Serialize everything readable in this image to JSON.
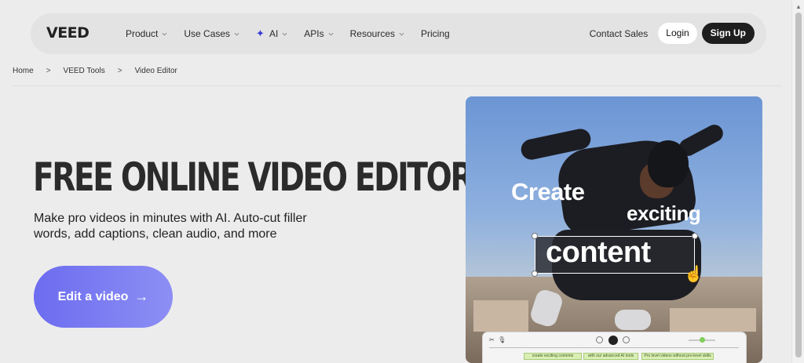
{
  "nav": {
    "logo": "VEED",
    "items": [
      {
        "label": "Product",
        "has_dropdown": true
      },
      {
        "label": "Use Cases",
        "has_dropdown": true
      },
      {
        "label": "AI",
        "has_dropdown": true,
        "icon": "sparkle-icon"
      },
      {
        "label": "APIs",
        "has_dropdown": true
      },
      {
        "label": "Resources",
        "has_dropdown": true
      },
      {
        "label": "Pricing",
        "has_dropdown": false
      }
    ],
    "contact_sales": "Contact Sales",
    "login": "Login",
    "signup": "Sign Up"
  },
  "breadcrumb": [
    "Home",
    "VEED Tools",
    "Video Editor"
  ],
  "hero": {
    "title": "FREE ONLINE VIDEO EDITOR",
    "subtitle": "Make pro videos in minutes with AI. Auto-cut filler words, add captions, clean audio, and more",
    "cta_label": "Edit a video",
    "cta_icon": "arrow-right-icon"
  },
  "media": {
    "overlay_line1": "Create",
    "overlay_line2": "exciting",
    "overlay_line3": "content",
    "clips": [
      "create exciting contents",
      "with our advanced AI tools",
      "Pro level videos without pro-level skills"
    ]
  },
  "colors": {
    "cta_gradient_start": "#6c6cf0",
    "cta_gradient_end": "#8d8ff4",
    "signup_bg": "#1e1e1e",
    "page_bg": "#ececec"
  }
}
